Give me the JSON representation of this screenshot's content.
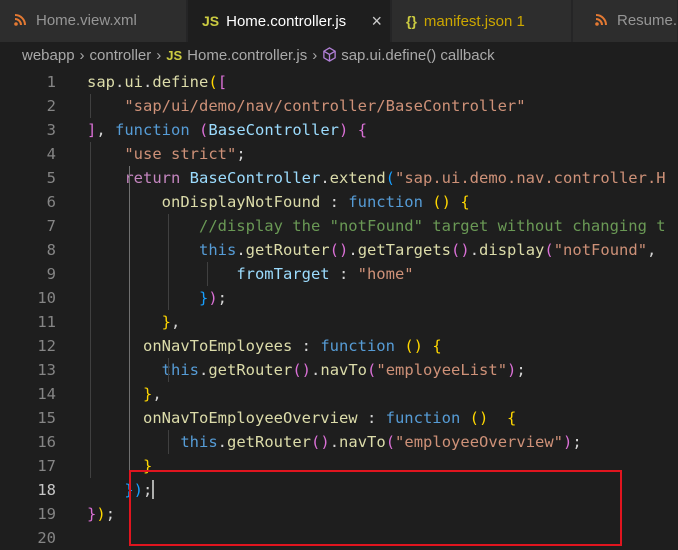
{
  "tabs": [
    {
      "label": "Home.view.xml",
      "icon": "rss-icon",
      "active": false
    },
    {
      "label": "Home.controller.js",
      "icon": "js-icon",
      "icon_text": "JS",
      "active": true,
      "close": "×"
    },
    {
      "label": "manifest.json",
      "icon": "json-icon",
      "icon_text": "{}",
      "badge": "1",
      "active": false
    },
    {
      "label": "Resume.v",
      "icon": "rss-icon",
      "active": false
    }
  ],
  "breadcrumb": {
    "items": [
      "webapp",
      "controller",
      "Home.controller.js",
      "sap.ui.define() callback"
    ],
    "js_icon_text": "JS",
    "separator": "›"
  },
  "editor": {
    "line_numbers": [
      "1",
      "2",
      "3",
      "4",
      "5",
      "6",
      "7",
      "8",
      "9",
      "10",
      "11",
      "12",
      "13",
      "14",
      "15",
      "16",
      "17",
      "18",
      "19",
      "20"
    ],
    "current_line": "18",
    "lines": [
      [
        [
          "fn",
          "sap"
        ],
        [
          "pl",
          "."
        ],
        [
          "fn",
          "ui"
        ],
        [
          "pl",
          "."
        ],
        [
          "fn",
          "define"
        ],
        [
          "b1",
          "("
        ],
        [
          "b2",
          "["
        ]
      ],
      [
        [
          "pl",
          "    "
        ],
        [
          "str",
          "\"sap/ui/demo/nav/controller/BaseController\""
        ]
      ],
      [
        [
          "b2",
          "]"
        ],
        [
          "pl",
          ", "
        ],
        [
          "kw",
          "function"
        ],
        [
          "pl",
          " "
        ],
        [
          "b2",
          "("
        ],
        [
          "var",
          "BaseController"
        ],
        [
          "b2",
          ")"
        ],
        [
          "pl",
          " "
        ],
        [
          "b2",
          "{"
        ]
      ],
      [
        [
          "pl",
          "    "
        ],
        [
          "str",
          "\"use strict\""
        ],
        [
          "pl",
          ";"
        ]
      ],
      [
        [
          "pl",
          "    "
        ],
        [
          "ctl",
          "return"
        ],
        [
          "pl",
          " "
        ],
        [
          "var",
          "BaseController"
        ],
        [
          "pl",
          "."
        ],
        [
          "fn",
          "extend"
        ],
        [
          "b3",
          "("
        ],
        [
          "str",
          "\"sap.ui.demo.nav.controller.H"
        ]
      ],
      [
        [
          "pl",
          "        "
        ],
        [
          "fn",
          "onDisplayNotFound"
        ],
        [
          "pl",
          " : "
        ],
        [
          "kw",
          "function"
        ],
        [
          "pl",
          " "
        ],
        [
          "b1",
          "("
        ],
        [
          "b1",
          ")"
        ],
        [
          "pl",
          " "
        ],
        [
          "b1",
          "{"
        ]
      ],
      [
        [
          "pl",
          "            "
        ],
        [
          "cmt",
          "//display the \"notFound\" target without changing t"
        ]
      ],
      [
        [
          "pl",
          "            "
        ],
        [
          "kw",
          "this"
        ],
        [
          "pl",
          "."
        ],
        [
          "fn",
          "getRouter"
        ],
        [
          "b2",
          "("
        ],
        [
          "b2",
          ")"
        ],
        [
          "pl",
          "."
        ],
        [
          "fn",
          "getTargets"
        ],
        [
          "b2",
          "("
        ],
        [
          "b2",
          ")"
        ],
        [
          "pl",
          "."
        ],
        [
          "fn",
          "display"
        ],
        [
          "b2",
          "("
        ],
        [
          "str",
          "\"notFound\""
        ],
        [
          "pl",
          ","
        ]
      ],
      [
        [
          "pl",
          "                "
        ],
        [
          "var",
          "fromTarget"
        ],
        [
          "pl",
          " : "
        ],
        [
          "str",
          "\"home\""
        ]
      ],
      [
        [
          "pl",
          "            "
        ],
        [
          "b3",
          "}"
        ],
        [
          "b2",
          ")"
        ],
        [
          "pl",
          ";"
        ]
      ],
      [
        [
          "pl",
          "        "
        ],
        [
          "b1",
          "}"
        ],
        [
          "pl",
          ","
        ]
      ],
      [
        [
          "pl",
          "      "
        ],
        [
          "fn",
          "onNavToEmployees"
        ],
        [
          "pl",
          " : "
        ],
        [
          "kw",
          "function"
        ],
        [
          "pl",
          " "
        ],
        [
          "b1",
          "("
        ],
        [
          "b1",
          ")"
        ],
        [
          "pl",
          " "
        ],
        [
          "b1",
          "{"
        ]
      ],
      [
        [
          "pl",
          "        "
        ],
        [
          "kw",
          "this"
        ],
        [
          "pl",
          "."
        ],
        [
          "fn",
          "getRouter"
        ],
        [
          "b2",
          "("
        ],
        [
          "b2",
          ")"
        ],
        [
          "pl",
          "."
        ],
        [
          "fn",
          "navTo"
        ],
        [
          "b2",
          "("
        ],
        [
          "str",
          "\"employeeList\""
        ],
        [
          "b2",
          ")"
        ],
        [
          "pl",
          ";"
        ]
      ],
      [
        [
          "pl",
          "      "
        ],
        [
          "b1",
          "}"
        ],
        [
          "pl",
          ","
        ]
      ],
      [
        [
          "pl",
          "      "
        ],
        [
          "fn",
          "onNavToEmployeeOverview"
        ],
        [
          "pl",
          " : "
        ],
        [
          "kw",
          "function"
        ],
        [
          "pl",
          " "
        ],
        [
          "b1",
          "("
        ],
        [
          "b1",
          ")"
        ],
        [
          "pl",
          "  "
        ],
        [
          "b1",
          "{"
        ]
      ],
      [
        [
          "pl",
          "          "
        ],
        [
          "kw",
          "this"
        ],
        [
          "pl",
          "."
        ],
        [
          "fn",
          "getRouter"
        ],
        [
          "b2",
          "("
        ],
        [
          "b2",
          ")"
        ],
        [
          "pl",
          "."
        ],
        [
          "fn",
          "navTo"
        ],
        [
          "b2",
          "("
        ],
        [
          "str",
          "\"employeeOverview\""
        ],
        [
          "b2",
          ")"
        ],
        [
          "pl",
          ";"
        ]
      ],
      [
        [
          "pl",
          "      "
        ],
        [
          "b1",
          "}"
        ]
      ],
      [
        [
          "pl",
          "    "
        ],
        [
          "b3",
          "}"
        ],
        [
          "b3",
          ")"
        ],
        [
          "pl",
          ";"
        ]
      ],
      [
        [
          "b2",
          "}"
        ],
        [
          "b1",
          ")"
        ],
        [
          "pl",
          ";"
        ]
      ],
      []
    ]
  },
  "colors": {
    "background": "#1e1e1e",
    "highlight_border": "#e0151f",
    "js_icon": "#cbcb41",
    "json_icon": "#cbcb41",
    "rss_icon": "#e37933",
    "warning_text": "#cca700"
  }
}
